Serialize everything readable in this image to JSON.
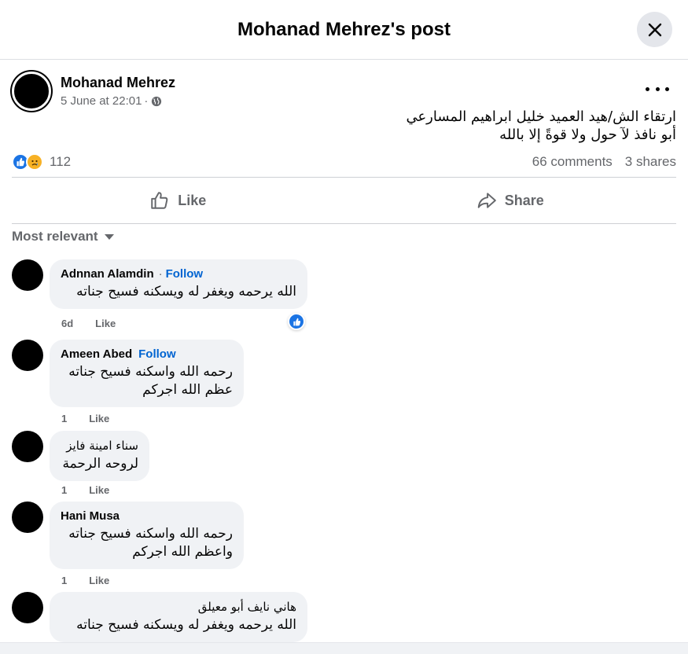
{
  "header": {
    "title": "Mohanad Mehrez's post"
  },
  "post": {
    "author": "Mohanad Mehrez",
    "timestamp": "5 June at 22:01",
    "separator": "·",
    "privacy_icon": "globe-icon",
    "text_lines": [
      "ارتقاء الش/هيد العميد خليل ابراهيم المسارعي",
      "أبو نافذ لآ حول ولا قوةً إلا بالله"
    ],
    "reaction_icons": [
      "like-icon",
      "sad-icon"
    ],
    "reaction_count": "112",
    "comments_count": "66 comments",
    "shares_count": "3 shares"
  },
  "actions": {
    "like_label": "Like",
    "share_label": "Share"
  },
  "sort": {
    "label": "Most relevant"
  },
  "comments": [
    {
      "name": "Adnnan Alamdin",
      "follow": "Follow",
      "follow_prefix": "·",
      "lines": [
        "الله يرحمه ويغفر له ويسكنه فسيح جناته"
      ],
      "age": "6d",
      "like": "Like",
      "has_reaction": true
    },
    {
      "name": "Ameen Abed",
      "follow": "Follow",
      "lines": [
        "رحمه الله واسكنه فسيح جناته",
        "عظم الله اجركم"
      ],
      "age": "1",
      "like": "Like"
    },
    {
      "name": "سناء امينة فايز",
      "lines": [
        "لروحه الرحمة"
      ],
      "age": "1",
      "like": "Like"
    },
    {
      "name": "Hani Musa",
      "lines": [
        "رحمه الله واسكنه فسيح جناته",
        "واعظم الله اجركم"
      ],
      "age": "1",
      "like": "Like"
    },
    {
      "name": "هاني نايف أبو معيلق",
      "lines": [
        "الله يرحمه ويغفر له ويسكنه فسيح جناته"
      ]
    }
  ],
  "colors": {
    "accent": "#0064d1",
    "like_blue": "#1b74e4",
    "bubble": "#f0f2f5",
    "muted": "#65676b"
  }
}
